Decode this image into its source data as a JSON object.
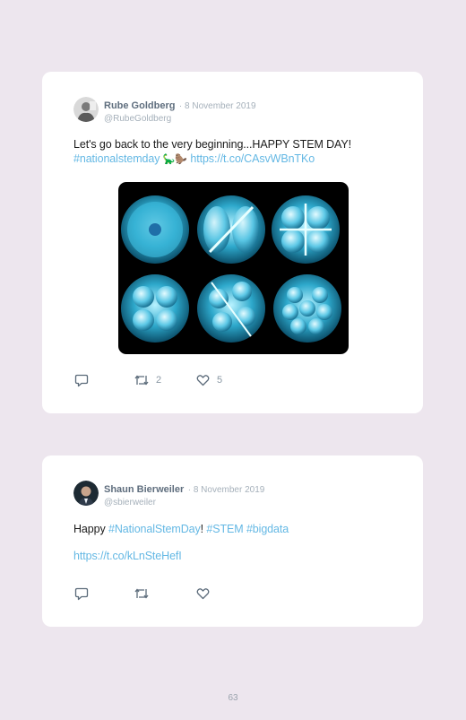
{
  "tweets": [
    {
      "author_name": "Rube Goldberg",
      "date": "· 8 November 2019",
      "handle": "@RubeGoldberg",
      "text_plain": "Let's go back to the very beginning...HAPPY STEM DAY!",
      "hashtag": "#nationalstemday",
      "emoji": "🦕🦫",
      "link": "https://t.co/CAsvWBnTKo",
      "image": "cell-division-stages-image",
      "reply_count": "",
      "retweet_count": "2",
      "like_count": "5"
    },
    {
      "author_name": "Shaun Bierweiler",
      "date": "· 8 November 2019",
      "handle": "@sbierweiler",
      "text_prefix": "Happy ",
      "hashtag_1": "#NationalStemDay",
      "text_mid": "! ",
      "hashtag_2": "#STEM",
      "hashtag_3": "#bigdata",
      "link": "https://t.co/kLnSteHefI",
      "reply_count": "",
      "retweet_count": "",
      "like_count": ""
    }
  ],
  "icons": [
    "reply-icon",
    "retweet-icon",
    "like-icon"
  ],
  "colors": {
    "background": "#ede6ee",
    "card": "#ffffff",
    "link": "#64b8e4",
    "name": "#5f6e7e",
    "meta": "#a5b0ba"
  },
  "page_number": "63"
}
